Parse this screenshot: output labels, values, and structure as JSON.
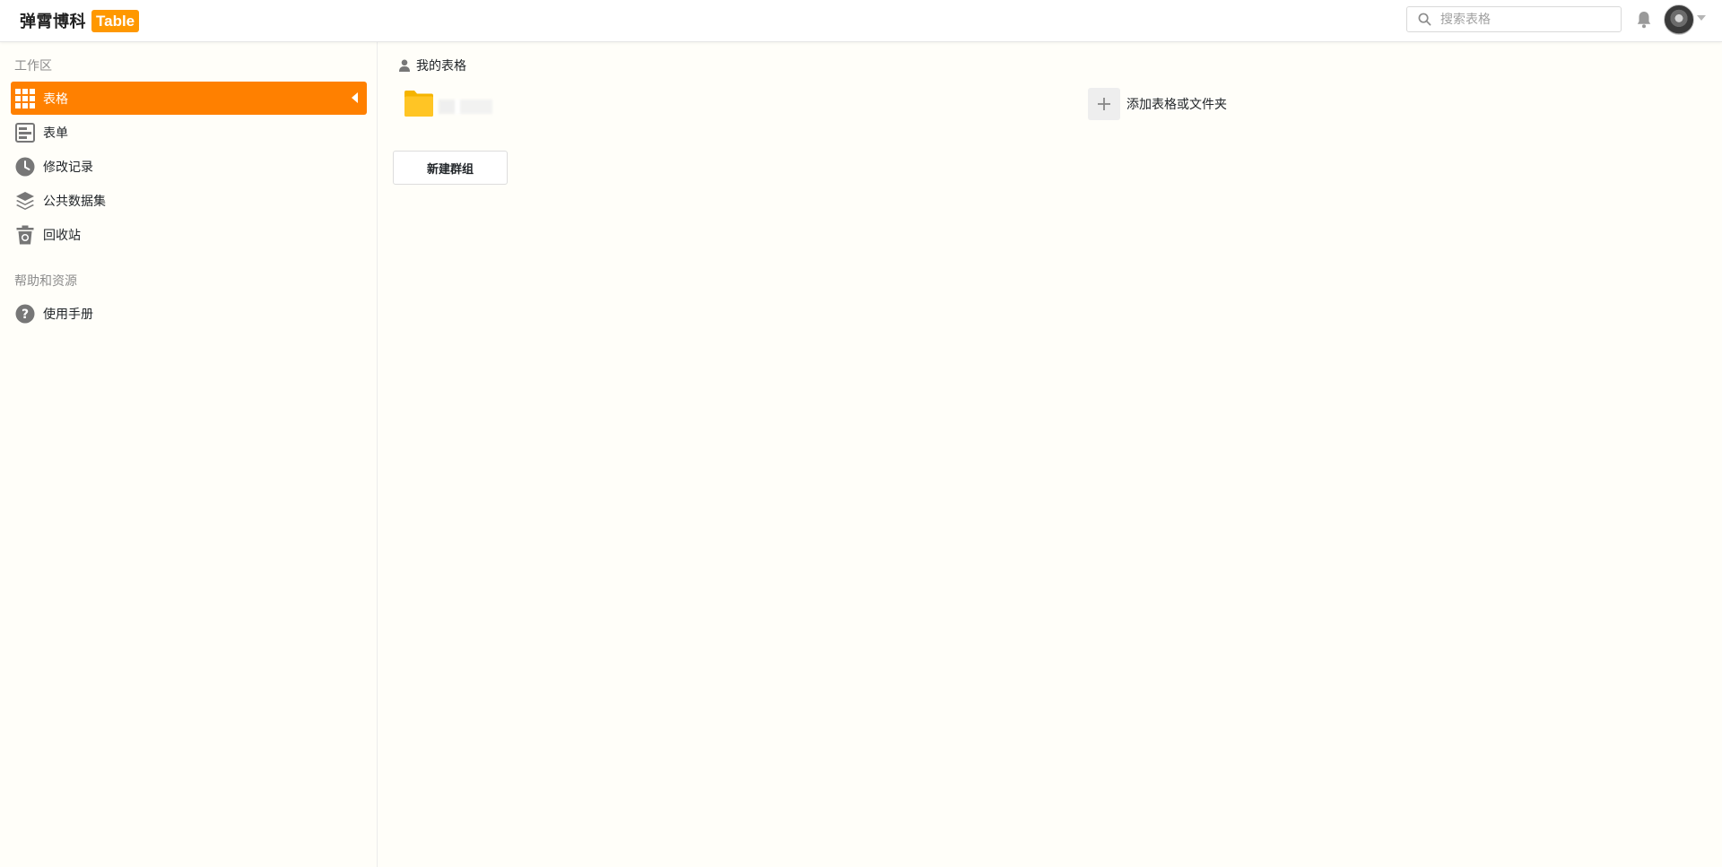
{
  "app": {
    "logo_text": "弹霄博科",
    "logo_badge": "Table"
  },
  "header": {
    "search_placeholder": "搜索表格",
    "search_icon": "search-icon",
    "notification_icon": "bell-icon",
    "avatar_icon": "user-avatar",
    "avatar_menu_icon": "caret-down-icon"
  },
  "sidebar": {
    "workspace_title": "工作区",
    "workspace_items": [
      {
        "label": "表格",
        "icon": "grid-icon",
        "active": true
      },
      {
        "label": "表单",
        "icon": "form-icon",
        "active": false
      },
      {
        "label": "修改记录",
        "icon": "clock-icon",
        "active": false
      },
      {
        "label": "公共数据集",
        "icon": "layers-icon",
        "active": false
      },
      {
        "label": "回收站",
        "icon": "trash-icon",
        "active": false
      }
    ],
    "help_title": "帮助和资源",
    "help_items": [
      {
        "label": "使用手册",
        "icon": "question-icon"
      }
    ],
    "accent_color": "#ff8000"
  },
  "main": {
    "section_title": "我的表格",
    "section_icon": "user-icon",
    "folder_icon": "folder-icon",
    "folder_color": "#ffc525",
    "add_label": "添加表格或文件夹",
    "add_icon": "plus-icon",
    "new_group_label": "新建群组"
  }
}
